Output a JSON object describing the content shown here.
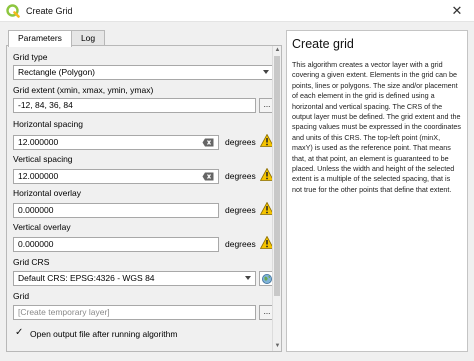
{
  "window": {
    "title": "Create Grid",
    "close_glyph": "✕"
  },
  "tabs": [
    {
      "label": "Parameters"
    },
    {
      "label": "Log"
    }
  ],
  "params": {
    "grid_type": {
      "label": "Grid type",
      "value": "Rectangle (Polygon)"
    },
    "grid_extent": {
      "label": "Grid extent (xmin, xmax, ymin, ymax)",
      "value": "-12, 84, 36, 84",
      "button": "..."
    },
    "h_spacing": {
      "label": "Horizontal spacing",
      "value": "12.000000",
      "unit": "degrees"
    },
    "v_spacing": {
      "label": "Vertical spacing",
      "value": "12.000000",
      "unit": "degrees"
    },
    "h_overlay": {
      "label": "Horizontal overlay",
      "value": "0.000000",
      "unit": "degrees"
    },
    "v_overlay": {
      "label": "Vertical overlay",
      "value": "0.000000",
      "unit": "degrees"
    },
    "grid_crs": {
      "label": "Grid CRS",
      "value": "Default CRS: EPSG:4326 - WGS 84"
    },
    "grid_output": {
      "label": "Grid",
      "placeholder": "[Create temporary layer]",
      "button": "..."
    },
    "open_output": {
      "label": "Open output file after running algorithm",
      "checked": true,
      "check_glyph": "✓"
    }
  },
  "help": {
    "title": "Create grid",
    "body": "This algorithm creates a vector layer with a grid covering a given extent. Elements in the grid can be points, lines or polygons. The size and/or placement of each element in the grid is defined using a horizontal and vertical spacing. The CRS of the output layer must be defined. The grid extent and the spacing values must be expressed in the coordinates and units of this CRS. The top-left point (minX, maxY) is used as the reference point. That means that, at that point, an element is guaranteed to be placed. Unless the width and height of the selected extent is a multiple of the selected spacing, that is not true for the other points that define that extent."
  },
  "colors": {
    "warning": "#f5c400",
    "qgis_green": "#8dc63f",
    "qgis_yellow": "#f3b81d"
  }
}
